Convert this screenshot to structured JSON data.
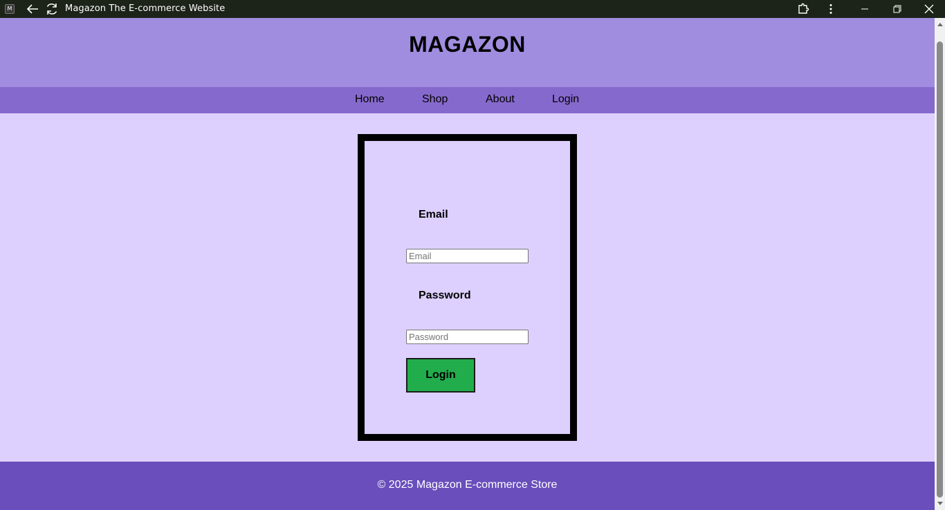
{
  "window": {
    "app_icon_letter": "M",
    "title": "Magazon The E-commerce Website"
  },
  "header": {
    "site_title": "MAGAZON"
  },
  "nav": {
    "items": [
      {
        "label": "Home"
      },
      {
        "label": "Shop"
      },
      {
        "label": "About"
      },
      {
        "label": "Login"
      }
    ]
  },
  "login_form": {
    "email_label": "Email",
    "email_placeholder": "Email",
    "email_value": "",
    "password_label": "Password",
    "password_placeholder": "Password",
    "password_value": "",
    "submit_label": "Login"
  },
  "footer": {
    "text": "© 2025 Magazon E-commerce Store"
  },
  "colors": {
    "titlebar": "#1c2319",
    "header": "#a08ddf",
    "nav": "#8669cd",
    "page_background": "#ddd0ff",
    "login_button": "#22ad4c",
    "footer": "#694ebc"
  },
  "icons": {
    "back": "arrow-left-icon",
    "reload": "reload-icon",
    "extensions": "extension-icon",
    "menu": "kebab-menu-icon",
    "minimize": "minimize-icon",
    "restore": "restore-icon",
    "close": "close-icon"
  }
}
